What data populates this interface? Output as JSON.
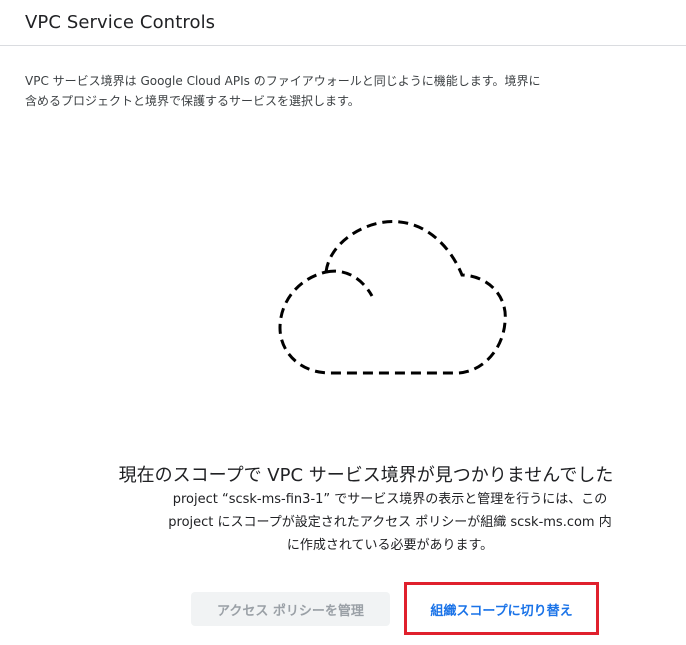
{
  "header": {
    "title": "VPC Service Controls"
  },
  "description": {
    "line1": "VPC サービス境界は Google Cloud APIs のファイアウォールと同じように機能します。境界に",
    "line2": "含めるプロジェクトと境界で保護するサービスを選択します。"
  },
  "empty_state": {
    "icon": "cloud-outline-dashed-icon",
    "title": "現在のスコープで VPC サービス境界が見つかりませんでした",
    "body_line1": "project “scsk-ms-fin3-1” でサービス境界の表示と管理を行うには、この",
    "body_line2": "project にスコープが設定されたアクセス ポリシーが組織 scsk-ms.com 内",
    "body_line3": "に作成されている必要があります。"
  },
  "actions": {
    "manage_policy_label": "アクセス ポリシーを管理",
    "switch_scope_label": "組織スコープに切り替え"
  },
  "colors": {
    "link": "#1a73e8",
    "highlight": "#e0202d",
    "disabled_bg": "#f1f3f4",
    "disabled_text": "#9aa0a6"
  }
}
